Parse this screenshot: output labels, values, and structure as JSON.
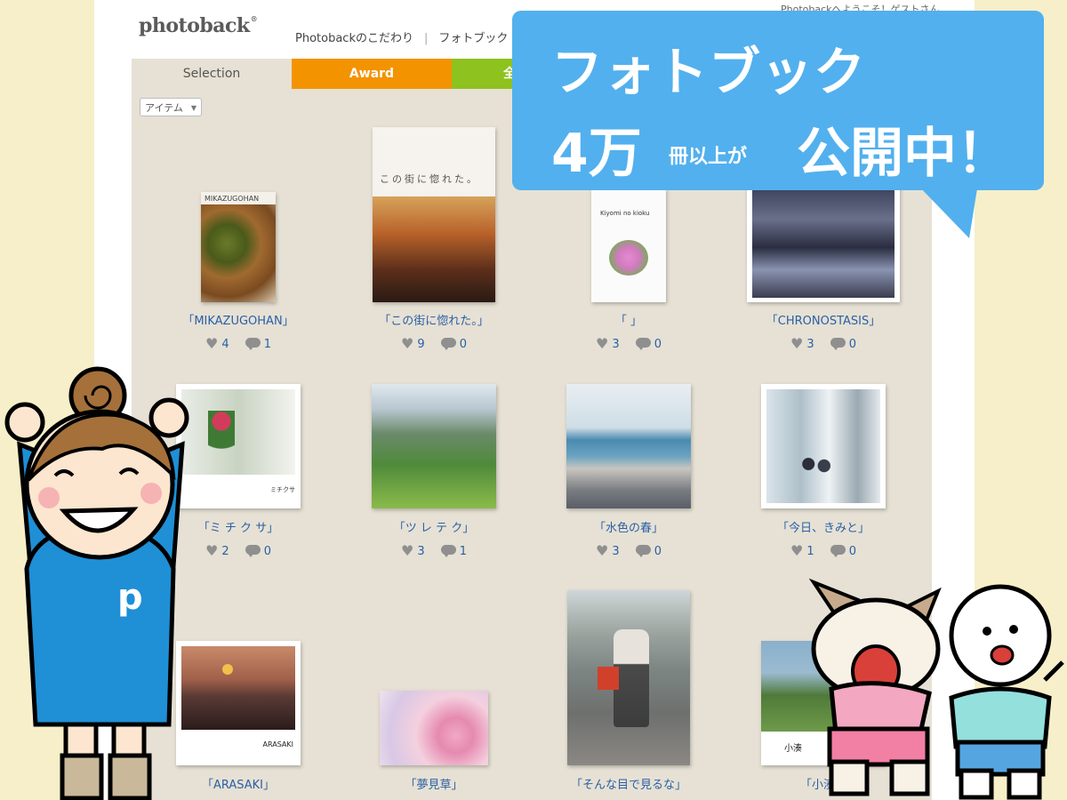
{
  "header": {
    "logo": "photoback",
    "welcome": "Photobackへようこそ！ゲストさん",
    "nav": [
      "Photobackのこだわり",
      "フォトブック"
    ]
  },
  "tabs": [
    {
      "label": "Selection"
    },
    {
      "label": "Award"
    },
    {
      "label": "全"
    }
  ],
  "filter": {
    "label": "アイテム"
  },
  "banner": {
    "line1": "フォトブック",
    "count": "4万",
    "count_suffix": "冊以上が",
    "status": "公開中！"
  },
  "books": [
    {
      "title": "「MIKAZUGOHAN」",
      "likes": "4",
      "comments": "1",
      "cover_text": "MIKAZUGOHAN"
    },
    {
      "title": "「この街に惚れた。」",
      "likes": "9",
      "comments": "0",
      "cover_text": "この街に惚れた。"
    },
    {
      "title": "「 」",
      "likes": "3",
      "comments": "0",
      "cover_text": "Kiyomi no kioku"
    },
    {
      "title": "「CHRONOSTASIS」",
      "likes": "3",
      "comments": "0",
      "cover_text": ""
    },
    {
      "title": "「ミ チ ク サ」",
      "likes": "2",
      "comments": "0",
      "cover_text": "ミチクサ"
    },
    {
      "title": "「ツ レ テ ク」",
      "likes": "3",
      "comments": "1",
      "cover_text": ""
    },
    {
      "title": "「水色の春」",
      "likes": "3",
      "comments": "0",
      "cover_text": ""
    },
    {
      "title": "「今日、きみと」",
      "likes": "1",
      "comments": "0",
      "cover_text": ""
    },
    {
      "title": "「ARASAKI」",
      "likes": "",
      "comments": "",
      "cover_text": "ARASAKI"
    },
    {
      "title": "「夢見草」",
      "likes": "",
      "comments": "",
      "cover_text": ""
    },
    {
      "title": "「そんな目で見るな」",
      "likes": "",
      "comments": "",
      "cover_text": ""
    },
    {
      "title": "「小湊」",
      "likes": "",
      "comments": "",
      "cover_text": "小湊"
    }
  ],
  "colors": {
    "award": "#f39300",
    "all": "#8dc21f",
    "banner": "#52b0ee",
    "link": "#2a5fa6"
  }
}
